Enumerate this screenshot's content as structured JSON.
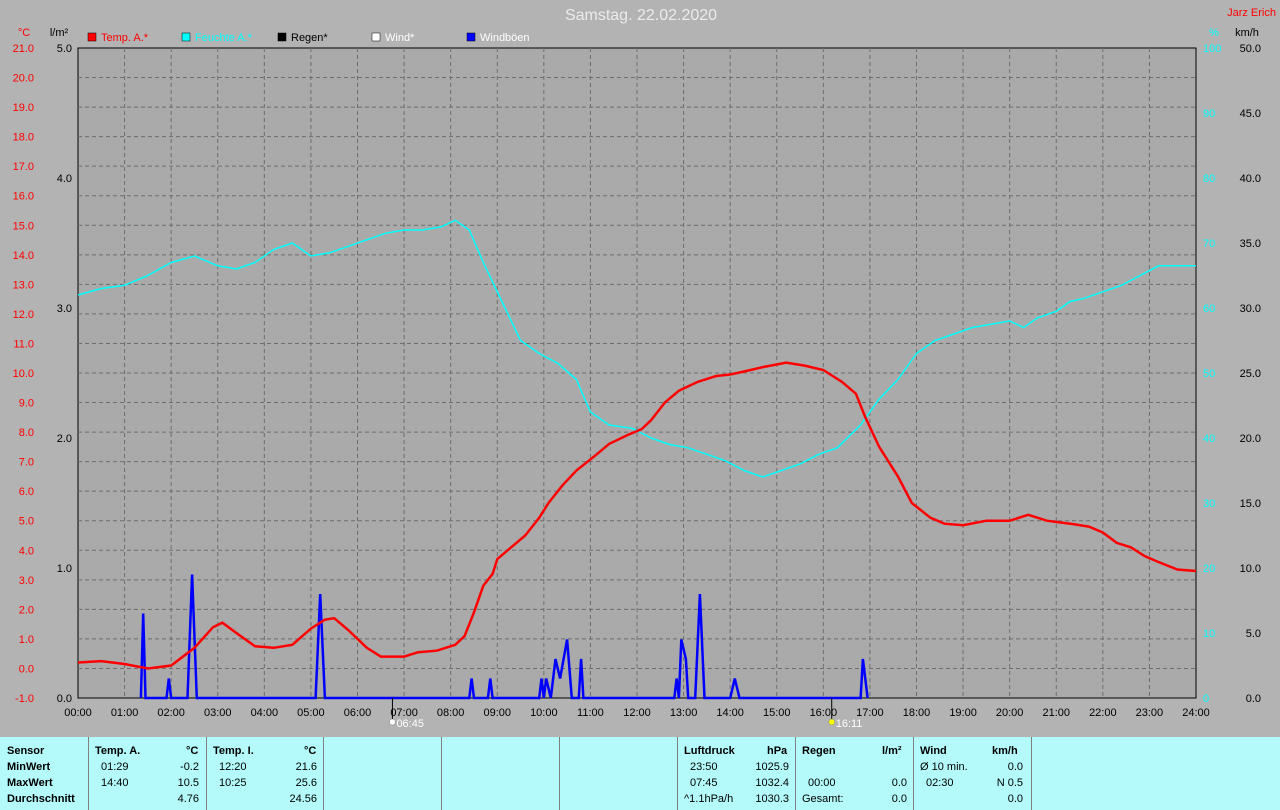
{
  "chart_data": {
    "type": "line",
    "title": "Samstag. 22.02.2020",
    "author": "Jarz Erich",
    "x_ticks": [
      "00:00",
      "01:00",
      "02:00",
      "03:00",
      "04:00",
      "05:00",
      "06:00",
      "07:00",
      "08:00",
      "09:00",
      "10:00",
      "11:00",
      "12:00",
      "13:00",
      "14:00",
      "15:00",
      "16:00",
      "17:00",
      "18:00",
      "19:00",
      "20:00",
      "21:00",
      "22:00",
      "23:00",
      "24:00"
    ],
    "x_range_hours": [
      0,
      24
    ],
    "grid": true,
    "legend_position": "top-left",
    "axes": {
      "temp": {
        "unit": "°C",
        "range": [
          -1,
          21
        ],
        "ticks": [
          "21.0",
          "20.0",
          "19.0",
          "18.0",
          "17.0",
          "16.0",
          "15.0",
          "14.0",
          "13.0",
          "12.0",
          "11.0",
          "10.0",
          "9.0",
          "8.0",
          "7.0",
          "6.0",
          "5.0",
          "4.0",
          "3.0",
          "2.0",
          "1.0",
          "0.0",
          "-1.0"
        ],
        "color": "#ff0000"
      },
      "rain": {
        "unit": "l/m²",
        "range": [
          0,
          5
        ],
        "ticks": [
          "5.0",
          "4.0",
          "3.0",
          "2.0",
          "1.0",
          "0.0"
        ],
        "color": "#000000"
      },
      "humidity": {
        "unit": "%",
        "range": [
          0,
          100
        ],
        "ticks": [
          "100",
          "90",
          "80",
          "70",
          "60",
          "50",
          "40",
          "30",
          "20",
          "10",
          "0"
        ],
        "color": "#00ffff"
      },
      "wind": {
        "unit": "km/h",
        "range": [
          0,
          50
        ],
        "ticks": [
          "50.0",
          "45.0",
          "40.0",
          "35.0",
          "30.0",
          "25.0",
          "20.0",
          "15.0",
          "10.0",
          "5.0",
          "0.0"
        ],
        "color": "#000000"
      }
    },
    "legend": [
      {
        "label": "Temp. A.*",
        "color": "#ff0000",
        "text_color": "#ff0000"
      },
      {
        "label": "Feuchte A.*",
        "color": "#00ffff",
        "text_color": "#00ffff"
      },
      {
        "label": "Regen*",
        "color": "#000000",
        "text_color": "#000000"
      },
      {
        "label": "Wind*",
        "color": "#ffffff",
        "text_color": "#ffffff"
      },
      {
        "label": "Windböen",
        "color": "#0000ff",
        "text_color": "#ffffff"
      }
    ],
    "series": [
      {
        "name": "Temp. A.*",
        "axis": "temp",
        "color": "#ff0000",
        "points": [
          [
            0,
            0.2
          ],
          [
            0.5,
            0.25
          ],
          [
            1,
            0.15
          ],
          [
            1.5,
            0
          ],
          [
            2,
            0.1
          ],
          [
            2.5,
            0.7
          ],
          [
            2.9,
            1.4
          ],
          [
            3.1,
            1.55
          ],
          [
            3.4,
            1.2
          ],
          [
            3.8,
            0.75
          ],
          [
            4.2,
            0.7
          ],
          [
            4.6,
            0.8
          ],
          [
            5,
            1.35
          ],
          [
            5.3,
            1.65
          ],
          [
            5.5,
            1.7
          ],
          [
            5.8,
            1.3
          ],
          [
            6.2,
            0.7
          ],
          [
            6.5,
            0.4
          ],
          [
            7,
            0.4
          ],
          [
            7.3,
            0.55
          ],
          [
            7.7,
            0.6
          ],
          [
            8.1,
            0.8
          ],
          [
            8.3,
            1.1
          ],
          [
            8.5,
            1.9
          ],
          [
            8.7,
            2.8
          ],
          [
            8.9,
            3.2
          ],
          [
            9,
            3.7
          ],
          [
            9.3,
            4.1
          ],
          [
            9.6,
            4.5
          ],
          [
            9.9,
            5.1
          ],
          [
            10.1,
            5.6
          ],
          [
            10.4,
            6.2
          ],
          [
            10.7,
            6.7
          ],
          [
            11.1,
            7.2
          ],
          [
            11.4,
            7.6
          ],
          [
            11.8,
            7.9
          ],
          [
            12.1,
            8.1
          ],
          [
            12.3,
            8.4
          ],
          [
            12.6,
            9.0
          ],
          [
            12.9,
            9.4
          ],
          [
            13.3,
            9.7
          ],
          [
            13.7,
            9.9
          ],
          [
            14,
            9.95
          ],
          [
            14.3,
            10.05
          ],
          [
            14.7,
            10.2
          ],
          [
            15.2,
            10.35
          ],
          [
            15.6,
            10.25
          ],
          [
            16,
            10.1
          ],
          [
            16.4,
            9.7
          ],
          [
            16.7,
            9.3
          ],
          [
            16.9,
            8.5
          ],
          [
            17.2,
            7.5
          ],
          [
            17.6,
            6.5
          ],
          [
            17.9,
            5.6
          ],
          [
            18.3,
            5.1
          ],
          [
            18.6,
            4.9
          ],
          [
            19,
            4.85
          ],
          [
            19.5,
            5.0
          ],
          [
            20,
            5.0
          ],
          [
            20.4,
            5.2
          ],
          [
            20.8,
            5.0
          ],
          [
            21.3,
            4.9
          ],
          [
            21.7,
            4.8
          ],
          [
            22,
            4.6
          ],
          [
            22.3,
            4.25
          ],
          [
            22.6,
            4.1
          ],
          [
            22.9,
            3.8
          ],
          [
            23.2,
            3.6
          ],
          [
            23.6,
            3.35
          ],
          [
            24,
            3.3
          ]
        ]
      },
      {
        "name": "Feuchte A.*",
        "axis": "humidity",
        "color": "#00ffff",
        "points": [
          [
            0,
            62
          ],
          [
            0.5,
            63
          ],
          [
            1,
            63.5
          ],
          [
            1.5,
            65
          ],
          [
            2,
            67
          ],
          [
            2.5,
            68
          ],
          [
            3,
            66.5
          ],
          [
            3.4,
            66
          ],
          [
            3.8,
            67
          ],
          [
            4.2,
            69
          ],
          [
            4.6,
            70
          ],
          [
            5,
            68
          ],
          [
            5.4,
            68.5
          ],
          [
            5.8,
            69.5
          ],
          [
            6.2,
            70.5
          ],
          [
            6.6,
            71.5
          ],
          [
            7,
            72
          ],
          [
            7.4,
            72
          ],
          [
            7.8,
            72.5
          ],
          [
            8.1,
            73.5
          ],
          [
            8.4,
            72
          ],
          [
            8.7,
            67
          ],
          [
            9.1,
            61
          ],
          [
            9.5,
            55
          ],
          [
            9.9,
            53
          ],
          [
            10.3,
            51.5
          ],
          [
            10.7,
            49
          ],
          [
            11,
            44
          ],
          [
            11.4,
            42
          ],
          [
            11.9,
            41.5
          ],
          [
            12.3,
            40
          ],
          [
            12.7,
            39
          ],
          [
            13.1,
            38.5
          ],
          [
            13.5,
            37.5
          ],
          [
            13.9,
            36.5
          ],
          [
            14.3,
            35
          ],
          [
            14.7,
            34
          ],
          [
            15.1,
            35
          ],
          [
            15.5,
            36
          ],
          [
            15.9,
            37.5
          ],
          [
            16.3,
            38.5
          ],
          [
            16.8,
            42
          ],
          [
            17.2,
            46
          ],
          [
            17.6,
            49
          ],
          [
            18,
            53
          ],
          [
            18.4,
            55
          ],
          [
            18.8,
            56
          ],
          [
            19.2,
            57
          ],
          [
            19.6,
            57.5
          ],
          [
            20,
            58
          ],
          [
            20.3,
            57
          ],
          [
            20.6,
            58.5
          ],
          [
            21,
            59.5
          ],
          [
            21.3,
            61
          ],
          [
            21.6,
            61.5
          ],
          [
            22,
            62.5
          ],
          [
            22.4,
            63.5
          ],
          [
            22.8,
            65
          ],
          [
            23.2,
            66.5
          ],
          [
            23.6,
            66.5
          ],
          [
            24,
            66.5
          ]
        ]
      }
    ],
    "gusts": {
      "name": "Windböen",
      "axis": "wind",
      "color": "#0000ff",
      "points": [
        [
          1.35,
          0
        ],
        [
          1.4,
          6.5
        ],
        [
          1.45,
          0
        ],
        [
          1.9,
          0
        ],
        [
          1.95,
          1.5
        ],
        [
          2.0,
          0
        ],
        [
          2.35,
          0
        ],
        [
          2.45,
          9.5
        ],
        [
          2.55,
          0
        ],
        [
          5.1,
          0
        ],
        [
          5.2,
          8
        ],
        [
          5.3,
          0
        ],
        [
          8.4,
          0
        ],
        [
          8.45,
          1.5
        ],
        [
          8.5,
          0
        ],
        [
          8.8,
          0
        ],
        [
          8.85,
          1.5
        ],
        [
          8.9,
          0
        ],
        [
          9.9,
          0
        ],
        [
          9.95,
          1.5
        ],
        [
          10.0,
          0
        ],
        [
          10.05,
          1.5
        ],
        [
          10.15,
          0
        ],
        [
          10.25,
          3
        ],
        [
          10.35,
          1.5
        ],
        [
          10.5,
          4.5
        ],
        [
          10.6,
          0
        ],
        [
          10.75,
          0
        ],
        [
          10.8,
          3
        ],
        [
          10.85,
          0
        ],
        [
          12.8,
          0
        ],
        [
          12.85,
          1.5
        ],
        [
          12.9,
          0
        ],
        [
          12.95,
          4.5
        ],
        [
          13.05,
          3
        ],
        [
          13.1,
          0
        ],
        [
          13.25,
          0
        ],
        [
          13.35,
          8
        ],
        [
          13.45,
          0
        ],
        [
          14.0,
          0
        ],
        [
          14.1,
          1.5
        ],
        [
          14.2,
          0
        ],
        [
          16.8,
          0
        ],
        [
          16.85,
          3
        ],
        [
          16.95,
          0
        ]
      ]
    },
    "markers": [
      {
        "label": "06:45",
        "hour": 6.75,
        "kind": "sunrise"
      },
      {
        "label": "16:11",
        "hour": 16.18,
        "kind": "sunset"
      }
    ]
  },
  "stats": {
    "sensor": {
      "header": "Sensor",
      "rows": [
        "MinWert",
        "MaxWert",
        "Durchschnitt"
      ]
    },
    "temp_a": {
      "header": "Temp. A.",
      "unit": "°C",
      "rows": [
        {
          "time": "01:29",
          "value": "-0.2"
        },
        {
          "time": "14:40",
          "value": "10.5"
        },
        {
          "time": "",
          "value": "4.76"
        }
      ]
    },
    "temp_i": {
      "header": "Temp. I.",
      "unit": "°C",
      "rows": [
        {
          "time": "12:20",
          "value": "21.6"
        },
        {
          "time": "10:25",
          "value": "25.6"
        },
        {
          "time": "",
          "value": "24.56"
        }
      ]
    },
    "pressure": {
      "header": "Luftdruck",
      "unit": "hPa",
      "rows": [
        {
          "time": "23:50",
          "value": "1025.9"
        },
        {
          "time": "07:45",
          "value": "1032.4"
        },
        {
          "time": "^1.1hPa/h",
          "value": "1030.3"
        }
      ]
    },
    "rain": {
      "header": "Regen",
      "unit": "l/m²",
      "rows": [
        {
          "time": "",
          "value": ""
        },
        {
          "time": "00:00",
          "value": "0.0"
        },
        {
          "time": "Gesamt:",
          "value": "0.0"
        }
      ]
    },
    "wind": {
      "header": "Wind",
      "unit": "km/h",
      "rows": [
        {
          "time": "Ø 10 min.",
          "value": "0.0"
        },
        {
          "time": "02:30",
          "value": "N 0.5"
        },
        {
          "time": "",
          "value": "0.0"
        }
      ]
    }
  }
}
